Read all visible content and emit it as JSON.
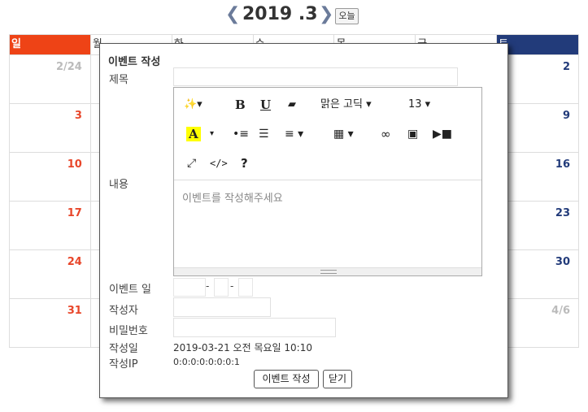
{
  "header": {
    "prev_icon": "chevron-left-icon",
    "next_icon": "chevron-right-icon",
    "title": "2019 .3",
    "today_label": "오늘"
  },
  "calendar": {
    "days_of_week": [
      "일",
      "월",
      "화",
      "수",
      "목",
      "금",
      "토"
    ],
    "weeks": [
      [
        "2/24",
        "",
        "",
        "",
        "",
        "",
        "2"
      ],
      [
        "3",
        "",
        "",
        "",
        "",
        "",
        "9"
      ],
      [
        "10",
        "",
        "",
        "",
        "",
        "",
        "16"
      ],
      [
        "17",
        "",
        "",
        "",
        "",
        "",
        "23"
      ],
      [
        "24",
        "",
        "",
        "",
        "",
        "",
        "30"
      ],
      [
        "31",
        "",
        "",
        "",
        "",
        "",
        "4/6"
      ]
    ]
  },
  "modal": {
    "title": "이벤트 작성",
    "labels": {
      "subject": "제목",
      "content": "내용",
      "event_date": "이벤트 일",
      "author": "작성자",
      "password": "비밀번호",
      "created": "작성일",
      "ip": "작성IP"
    },
    "editor": {
      "font_name": "맑은 고딕",
      "font_size": "13",
      "placeholder": "이벤트를 작성해주세요",
      "toolbar_icons": [
        "magic-icon",
        "bold-icon",
        "underline-icon",
        "eraser-icon",
        "font-family-select",
        "font-size-select",
        "font-color-icon",
        "bullet-list-icon",
        "numbered-list-icon",
        "align-icon",
        "table-icon",
        "link-icon",
        "image-icon",
        "video-icon",
        "fullscreen-icon",
        "code-view-icon",
        "help-icon"
      ]
    },
    "date_separator": "-",
    "created_value": "2019-03-21 오전 목요일 10:10",
    "ip_value": "0:0:0:0:0:0:0:1",
    "submit_label": "이벤트 작성",
    "close_label": "닫기"
  },
  "colors": {
    "sunday_header": "#ee4316",
    "saturday_header": "#223b7a",
    "sunday_text": "#e8462a",
    "saturday_text": "#223b7a"
  }
}
